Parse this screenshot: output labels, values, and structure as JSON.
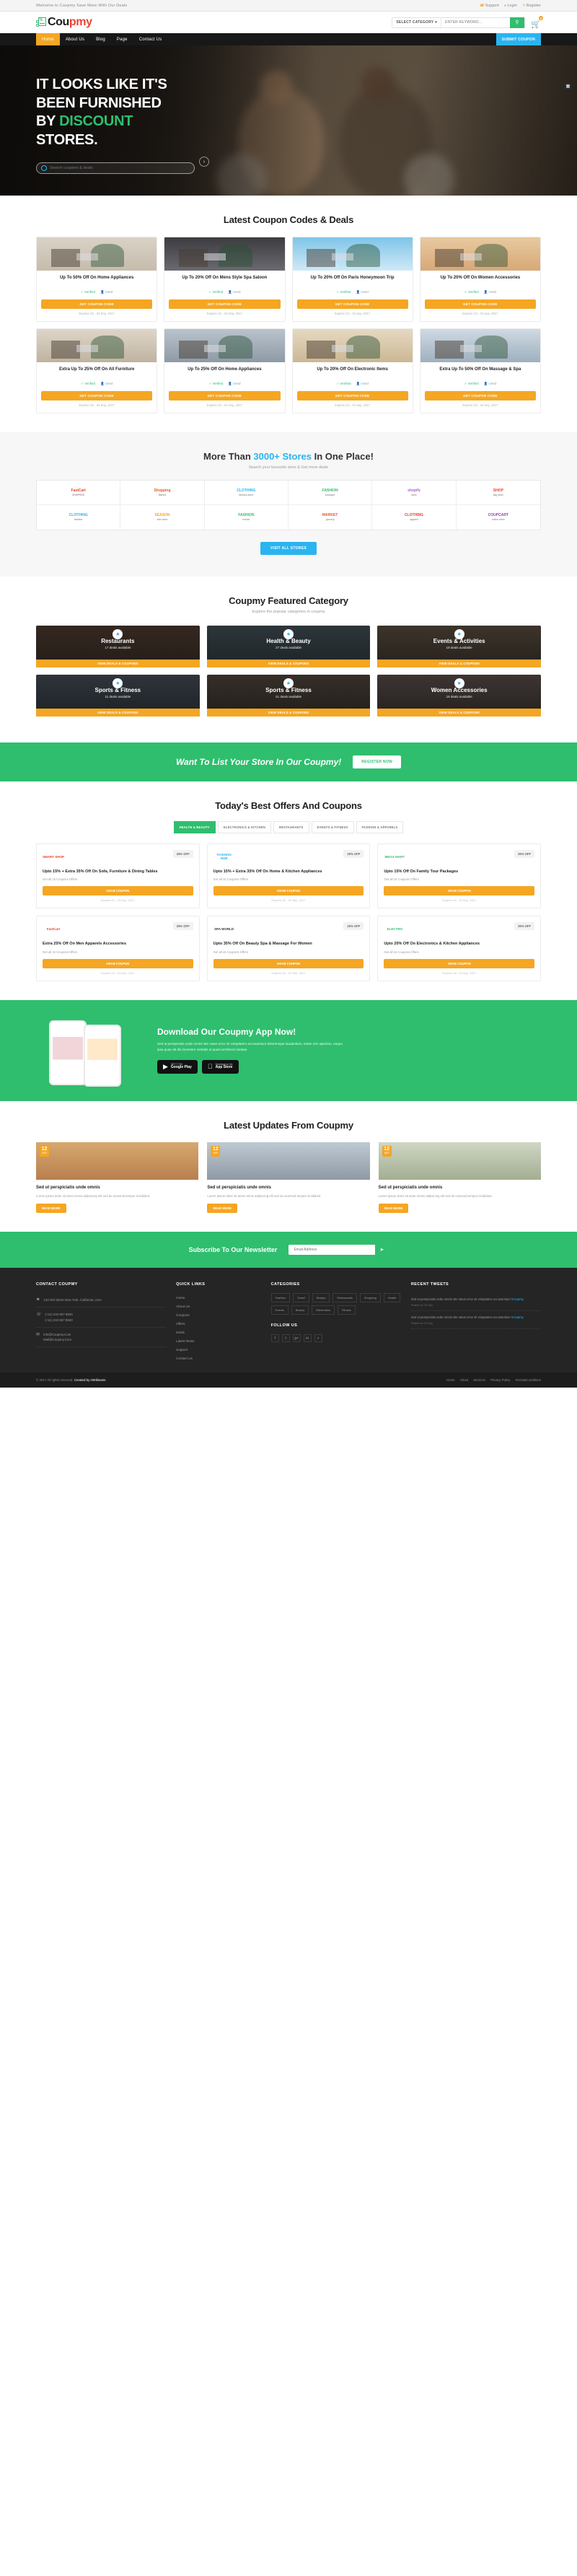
{
  "topbar": {
    "welcome": "Welcome to Coupmy Save More With Our Deals",
    "links": [
      {
        "label": "Support",
        "icon": "headset-icon"
      },
      {
        "label": "Login",
        "icon": "user-icon"
      },
      {
        "label": "Register",
        "icon": "pencil-icon"
      }
    ]
  },
  "header": {
    "logo": {
      "part1": "Cou",
      "part2": "pmy",
      "percent": "%"
    },
    "search": {
      "category": "SELECT CATEGORY",
      "placeholder": "ENTER KEYWORD...",
      "icon": "search-icon"
    },
    "cart": {
      "count": "0",
      "icon": "cart-icon"
    }
  },
  "nav": {
    "items": [
      {
        "label": "Home",
        "active": true
      },
      {
        "label": "About Us",
        "active": false
      },
      {
        "label": "Blog",
        "active": false
      },
      {
        "label": "Page",
        "active": false
      },
      {
        "label": "Contact Us",
        "active": false
      }
    ],
    "cta": "SUBMIT COUPON"
  },
  "hero": {
    "line1": "IT LOOKS LIKE IT'S",
    "line2": "BEEN FURNISHED",
    "line3_plain": "BY ",
    "line3_green": "DISCOUNT",
    "line4": "STORES.",
    "search_placeholder": "Search coupons & deals",
    "search_icon": "search-icon",
    "arrow_icon": "arrow-right-icon",
    "grid_icon": "grid-icon"
  },
  "latest": {
    "title": "Latest Coupon Codes & Deals",
    "coupons": [
      {
        "title": "Up To 50% Off On Home Appliances",
        "verified": "Verified",
        "used": "Used",
        "button": "GET COUPON CODE",
        "expires": "Expires On : 03 Sep, 2017",
        "art": "appliances"
      },
      {
        "title": "Up To 20% Off On Mens Style Spa Saloon",
        "verified": "Verified",
        "used": "Used",
        "button": "GET COUPON CODE",
        "expires": "Expires On : 03 Sep, 2017",
        "art": "salon"
      },
      {
        "title": "Up To 20% Off On Paris Honeymoon Trip",
        "verified": "Verified",
        "used": "Used",
        "button": "GET COUPON CODE",
        "expires": "Expires On : 03 Sep, 2017",
        "art": "travel"
      },
      {
        "title": "Up To 20% Off On Women Accessories",
        "verified": "Verified",
        "used": "Used",
        "button": "GET COUPON CODE",
        "expires": "Expires On : 03 Sep, 2017",
        "art": "shopping"
      },
      {
        "title": "Extra Up To 25% Off On All Furniture",
        "verified": "Verified",
        "used": "Used",
        "button": "GET COUPON CODE",
        "expires": "Expires On : 03 Sep, 2017",
        "art": "furniture"
      },
      {
        "title": "Up To 25% Off On Home Appliances",
        "verified": "Verified",
        "used": "Used",
        "button": "GET COUPON CODE",
        "expires": "Expires On : 03 Sep, 2017",
        "art": "office"
      },
      {
        "title": "Up To 20% Off On Electronic Items",
        "verified": "Verified",
        "used": "Used",
        "button": "GET COUPON CODE",
        "expires": "Expires On : 03 Sep, 2017",
        "art": "kitchen"
      },
      {
        "title": "Extra Up To 50% Off On Massage & Spa",
        "verified": "Verified",
        "used": "Used",
        "button": "GET COUPON CODE",
        "expires": "Expires On : 03 Sep, 2017",
        "art": "spa"
      }
    ]
  },
  "stores": {
    "title_pre": "More Than ",
    "title_count": "3000+ Stores",
    "title_post": " In One Place!",
    "subtitle": "Search your favourite store & Get more deals",
    "button": "VISIT ALL STORES",
    "items": [
      {
        "name": "FastCart",
        "sub": "SHOPPING",
        "color": "#e8402a"
      },
      {
        "name": "Shopping",
        "sub": "Market",
        "color": "#e05a2b"
      },
      {
        "name": "CLOTHING",
        "sub": "fashion store",
        "color": "#2ab4f0"
      },
      {
        "name": "FASHION",
        "sub": "boutique",
        "color": "#2fbe6e"
      },
      {
        "name": "shopify",
        "sub": "store",
        "color": "#b05ad1"
      },
      {
        "name": "SHOP",
        "sub": "bag store",
        "color": "#e8402a"
      },
      {
        "name": "CLOTHING",
        "sub": "fashion",
        "color": "#2ab4f0"
      },
      {
        "name": "SEASON",
        "sub": "sale store",
        "color": "#f5a623"
      },
      {
        "name": "FASHION",
        "sub": "trends",
        "color": "#2fbe6e"
      },
      {
        "name": "MARKET",
        "sub": "grocery",
        "color": "#e05a2b"
      },
      {
        "name": "CLOTHING",
        "sub": "apparel",
        "color": "#e8402a"
      },
      {
        "name": "COUPCART",
        "sub": "online store",
        "color": "#8e44ad"
      }
    ]
  },
  "featured": {
    "title": "Coupmy Featured Category",
    "subtitle": "Explore the popular categories in coupmy",
    "cards": [
      {
        "title": "Restaurants",
        "sub": "17 deals available",
        "bar": "VIEW DEALS & COUPONS",
        "icon": "cutlery-icon",
        "art": "resto"
      },
      {
        "title": "Health & Beauty",
        "sub": "27 deals available",
        "bar": "VIEW DEALS & COUPONS",
        "icon": "heart-icon",
        "art": "health"
      },
      {
        "title": "Events & Activities",
        "sub": "19 deals available",
        "bar": "VIEW DEALS & COUPONS",
        "icon": "ticket-icon",
        "art": "events"
      },
      {
        "title": "Sports & Fitness",
        "sub": "11 deals available",
        "bar": "VIEW DEALS & COUPONS",
        "icon": "dumbbell-icon",
        "art": "sports"
      },
      {
        "title": "Sports & Fitness",
        "sub": "21 deals available",
        "bar": "VIEW DEALS & COUPONS",
        "icon": "bike-icon",
        "art": "fitness"
      },
      {
        "title": "Women Accessories",
        "sub": "19 deals available",
        "bar": "VIEW DEALS & COUPONS",
        "icon": "bag-icon",
        "art": "women"
      }
    ]
  },
  "listcta": {
    "heading": "Want To List Your Store In Our Coupmy!",
    "button": "REGISTER NOW"
  },
  "offers": {
    "title": "Today's Best Offers And Coupons",
    "tabs": [
      {
        "label": "HEALTH & BEAUTY",
        "active": true
      },
      {
        "label": "ELECTRONICS & KITCHEN",
        "active": false
      },
      {
        "label": "RESTAURANTS",
        "active": false
      },
      {
        "label": "EVENTS & FITNESS",
        "active": false
      },
      {
        "label": "FASHION & APPARELS",
        "active": false
      }
    ],
    "cards": [
      {
        "logo": "SMART SHOP",
        "logo_color": "#e8402a",
        "badge": "25% OFF",
        "title": "Upto 15% + Extra 35% Off On Sofa, Furniture & Dining Tables",
        "sub": "Get all 15 Coupons Offers",
        "button": "GRAB COUPON",
        "expires": "Expires On : 03 Sep, 2017"
      },
      {
        "logo": "FASHION HUB",
        "logo_color": "#2ab4f0",
        "badge": "25% OFF",
        "title": "Upto 15% + Extra 35% Off On Home & Kitchen Appliances",
        "sub": "Get all 15 Coupons Offers",
        "button": "GRAB COUPON",
        "expires": "Expires On : 03 Sep, 2017"
      },
      {
        "logo": "MEGA MART",
        "logo_color": "#2fbe6e",
        "badge": "25% OFF",
        "title": "Upto 15% Off On Family Tour Packages",
        "sub": "Get all 15 Coupons Offers",
        "button": "GRAB COUPON",
        "expires": "Expires On : 03 Sep, 2017"
      },
      {
        "logo": "FastCart",
        "logo_color": "#e8402a",
        "badge": "25% OFF",
        "title": "Extra 25% Off On Men Apparels Accessories",
        "sub": "Get all 15 Coupons Offers",
        "button": "GRAB COUPON",
        "expires": "Expires On : 03 Sep, 2017"
      },
      {
        "logo": "SPA WORLD",
        "logo_color": "#333333",
        "badge": "25% OFF",
        "title": "Upto 35% Off On Beauty Spa & Massage For Women",
        "sub": "Get all 15 Coupons Offers",
        "button": "GRAB COUPON",
        "expires": "Expires On : 03 Sep, 2017"
      },
      {
        "logo": "ELECTRO",
        "logo_color": "#2fbe6e",
        "badge": "25% OFF",
        "title": "Upto 20% Off On Electronics & Kitchen Appliances",
        "sub": "Get all 15 Coupons Offers",
        "button": "GRAB COUPON",
        "expires": "Expires On : 03 Sep, 2017"
      }
    ]
  },
  "app": {
    "title": "Download Our Coupmy App Now!",
    "desc": "Sed ut perspiciatis unde omnis iste natus error sit voluptatem accusantium doloremque laudantium, totam rem aperiam, eaque ipsa quae ab illo inventore veritatis et quasi architecto beatae.",
    "stores": [
      {
        "small": "GET IT ON",
        "big": "Google Play",
        "icon": "play-icon"
      },
      {
        "small": "Download on the",
        "big": "App Store",
        "icon": "apple-icon"
      }
    ]
  },
  "blog": {
    "title": "Latest Updates From Coupmy",
    "posts": [
      {
        "day": "12",
        "month": "SEP",
        "title": "Sed ut perspiciatis unde omnis",
        "excerpt": "Lorem ipsum dolor sit amet omnis adipiscing elit sed do eiusmod tempor incididunt.",
        "button": "READ MORE",
        "art": "blog1"
      },
      {
        "day": "12",
        "month": "SEP",
        "title": "Sed ut perspiciatis unde omnis",
        "excerpt": "Lorem ipsum dolor sit amet omnis adipiscing elit sed do eiusmod tempor incididunt.",
        "button": "READ MORE",
        "art": "blog2"
      },
      {
        "day": "12",
        "month": "SEP",
        "title": "Sed ut perspiciatis unde omnis",
        "excerpt": "Lorem ipsum dolor sit amet omnis adipiscing elit sed do eiusmod tempor incididunt.",
        "button": "READ MORE",
        "art": "blog3"
      }
    ]
  },
  "newsletter": {
    "title": "Subscribe To Our Newsletter",
    "placeholder": "Email Address",
    "button_icon": "send-icon"
  },
  "footer": {
    "contact": {
      "heading": "CONTACT COUPMY",
      "address": {
        "icon": "map-pin-icon",
        "lines": "123 Old Street New York, California, USA"
      },
      "phone": {
        "icon": "phone-icon",
        "lines": "(+11) 234 567 8520\n(+11) 234 567 8520"
      },
      "email": {
        "icon": "mail-icon",
        "lines": "Info@Coupmy.Com\nMail@Coupmy.Com"
      }
    },
    "quicklinks": {
      "heading": "QUICK LINKS",
      "items": [
        "Home",
        "About Us",
        "Coupons",
        "Offers",
        "Deals",
        "Latest News",
        "Support",
        "Contact Us"
      ]
    },
    "categories": {
      "heading": "CATEGORIES",
      "chips": [
        "Fashion",
        "Travel",
        "Beauty",
        "Restaurants",
        "Shopping",
        "Health",
        "Events",
        "Beauty",
        "Electronics",
        "Fitness"
      ]
    },
    "follow": {
      "heading": "FOLLOW US",
      "socials": [
        "facebook-icon",
        "twitter-icon",
        "google-plus-icon",
        "linkedin-icon",
        "rss-icon"
      ]
    },
    "tweets": {
      "heading": "RECENT TWEETS",
      "items": [
        {
          "text": "Sed ut perspiciatis unde omnis iste natus error sit voluptatem accusantium ",
          "link": "#coupmy",
          "date": "Posted on 24 July"
        },
        {
          "text": "Sed ut perspiciatis unde omnis iste natus error sit voluptatem accusantium ",
          "link": "#coupmy",
          "date": "Posted on 24 July"
        }
      ]
    },
    "copyright_main": "© 2017 All rights reserved",
    "copyright_by": "Created by Htmlbeans",
    "bottom_links": [
      "Home",
      "About",
      "Services",
      "Privacy Policy",
      "Terms&Conditions"
    ]
  }
}
